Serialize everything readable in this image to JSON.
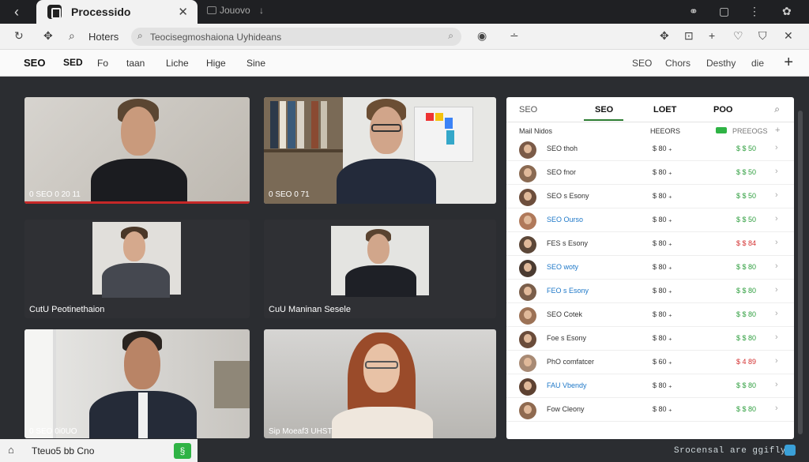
{
  "titlebar": {
    "tab_title": "Processido",
    "tab2_label": "Jouovo",
    "tab2_extra": "↓",
    "right_icons": [
      "link-icon",
      "window-icon",
      "more-icon",
      "settings-icon"
    ]
  },
  "addressbar": {
    "label": "Hoters",
    "url": "Teocisegmoshaiona Uyhideans"
  },
  "menubar": {
    "items": [
      "SEO",
      "SED",
      "Fo",
      "taan",
      "Liche",
      "Hige",
      "Sine"
    ],
    "right_items": [
      "SEO",
      "Chors",
      "Desthy",
      "die"
    ]
  },
  "tiles": [
    {
      "caption": "0 SEO 0 20 11"
    },
    {
      "caption": "0 SEO 0 71"
    },
    {
      "caption": "CutU Peotinethaion"
    },
    {
      "caption": "CuU Maninan Sesele"
    },
    {
      "caption": "0 SEO 0i0UO"
    },
    {
      "caption": "Sip Moeaf3 UHST"
    }
  ],
  "panel": {
    "tabs": [
      "SEO",
      "SEO",
      "LOET",
      "POO"
    ],
    "headers": {
      "name": "Mail Nidos",
      "col1": "HEEORS",
      "col2": "PREEOGS"
    },
    "rows": [
      {
        "name": "SEO thoh",
        "v1": "$ 80 ₊",
        "v2": "$ $ 50",
        "v2_color": "green"
      },
      {
        "name": "SEO fnor",
        "v1": "$ 80 ₊",
        "v2": "$ $ 50",
        "v2_color": "green"
      },
      {
        "name": "SEO s Esony",
        "v1": "$ 80 ₊",
        "v2": "$ $ 50",
        "v2_color": "green"
      },
      {
        "name": "SEO Ourso",
        "v1": "$ 80 ₊",
        "v2": "$ $ 50",
        "v2_color": "green",
        "blue": true
      },
      {
        "name": "FES s Esony",
        "v1": "$ 80 ₊",
        "v2": "$ $ 84",
        "v2_color": "red"
      },
      {
        "name": "SEO woty",
        "v1": "$ 80 ₊",
        "v2": "$ $ 80",
        "v2_color": "green",
        "blue": true
      },
      {
        "name": "FEO s Esony",
        "v1": "$ 80 ₊",
        "v2": "$ $ 80",
        "v2_color": "green",
        "blue": true
      },
      {
        "name": "SEO Cotek",
        "v1": "$ 80 ₊",
        "v2": "$ $ 80",
        "v2_color": "green"
      },
      {
        "name": "Foe s Esony",
        "v1": "$ 80 ₊",
        "v2": "$ $ 80",
        "v2_color": "green"
      },
      {
        "name": "PhO comfatcer",
        "v1": "$ 60 ₊",
        "v2": "$ 4 89",
        "v2_color": "red"
      },
      {
        "name": "FAU Vbendy",
        "v1": "$ 80 ₊",
        "v2": "$ $ 80",
        "v2_color": "green",
        "blue": true
      },
      {
        "name": "Fow Cleony",
        "v1": "$ 80 ₊",
        "v2": "$ $ 80",
        "v2_color": "green"
      }
    ]
  },
  "statusbar": {
    "left_text": "Tteuo5 bb Cno",
    "button_label": "§",
    "right_text": "Srocensal are ggifly"
  }
}
